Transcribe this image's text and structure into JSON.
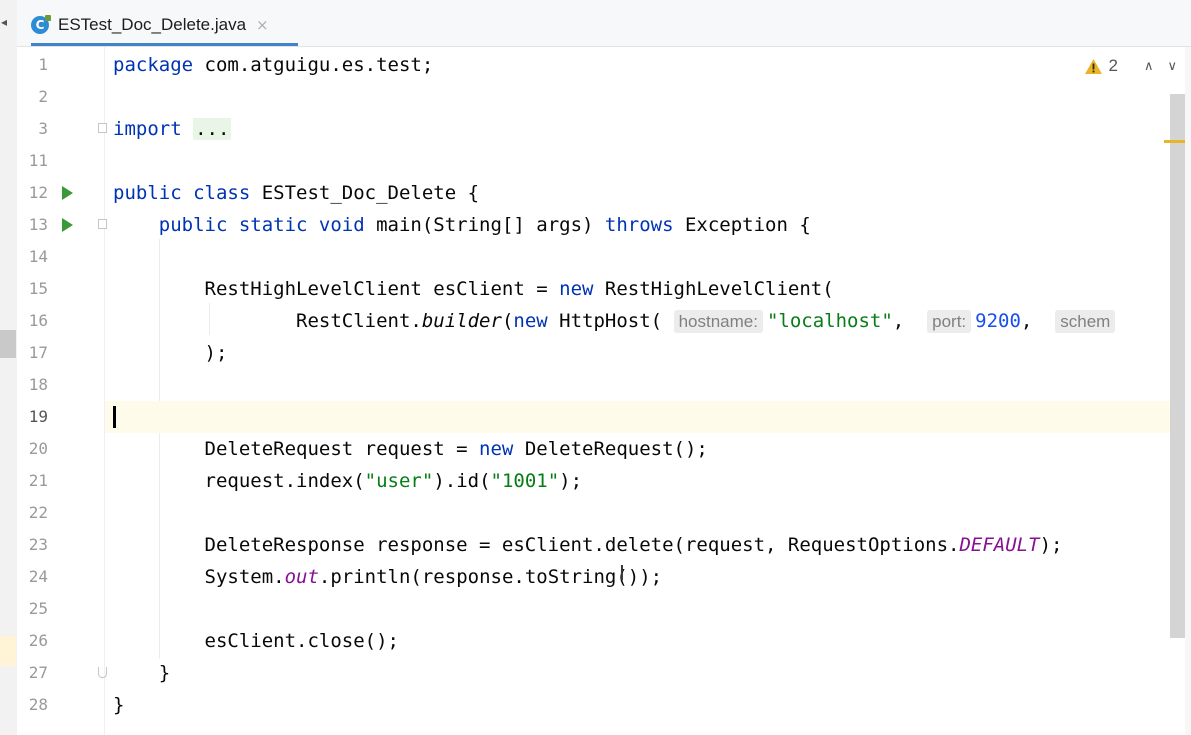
{
  "tab": {
    "icon_letter": "C",
    "file_name": "ESTest_Doc_Delete.java",
    "close": "×"
  },
  "inspection": {
    "warning_count": "2",
    "prev": "∧",
    "next": "∨"
  },
  "colors": {
    "keyword": "#0033b3",
    "string": "#067d17",
    "number": "#1750eb",
    "static_field": "#871094",
    "run_icon": "#3a9a3a",
    "warning": "#e8b429"
  },
  "lines": [
    {
      "num": "1",
      "parts": [
        [
          "kw",
          "package"
        ],
        [
          "t",
          " com.atguigu.es.test;"
        ]
      ]
    },
    {
      "num": "2",
      "parts": []
    },
    {
      "num": "3",
      "fold": "start",
      "parts": [
        [
          "kw",
          "import"
        ],
        [
          "t",
          " "
        ],
        [
          "folded",
          "..."
        ]
      ]
    },
    {
      "num": "11",
      "parts": []
    },
    {
      "num": "12",
      "run": true,
      "parts": [
        [
          "kw",
          "public class"
        ],
        [
          "t",
          " ESTest_Doc_Delete {"
        ]
      ]
    },
    {
      "num": "13",
      "run": true,
      "fold": "start",
      "parts": [
        [
          "t",
          "    "
        ],
        [
          "kw",
          "public static void"
        ],
        [
          "t",
          " main(String[] args) "
        ],
        [
          "kw",
          "throws"
        ],
        [
          "t",
          " Exception {"
        ]
      ]
    },
    {
      "num": "14",
      "parts": []
    },
    {
      "num": "15",
      "parts": [
        [
          "t",
          "        RestHighLevelClient esClient = "
        ],
        [
          "kw",
          "new"
        ],
        [
          "t",
          " RestHighLevelClient("
        ]
      ]
    },
    {
      "num": "16",
      "parts": [
        [
          "t",
          "                RestClient."
        ],
        [
          "ital",
          "builder"
        ],
        [
          "t",
          "("
        ],
        [
          "kw",
          "new"
        ],
        [
          "t",
          " HttpHost( "
        ],
        [
          "hint",
          "hostname:"
        ],
        [
          "str",
          "\"localhost\""
        ],
        [
          "t",
          ",  "
        ],
        [
          "hint",
          "port:"
        ],
        [
          "num",
          "9200"
        ],
        [
          "t",
          ",  "
        ],
        [
          "hint",
          "schem"
        ]
      ]
    },
    {
      "num": "17",
      "parts": [
        [
          "t",
          "        );"
        ]
      ]
    },
    {
      "num": "18",
      "parts": []
    },
    {
      "num": "19",
      "current": true,
      "parts": []
    },
    {
      "num": "20",
      "parts": [
        [
          "t",
          "        DeleteRequest request = "
        ],
        [
          "kw",
          "new"
        ],
        [
          "t",
          " DeleteRequest();"
        ]
      ]
    },
    {
      "num": "21",
      "parts": [
        [
          "t",
          "        request.index("
        ],
        [
          "str",
          "\"user\""
        ],
        [
          "t",
          ").id("
        ],
        [
          "str",
          "\"1001\""
        ],
        [
          "t",
          ");"
        ]
      ]
    },
    {
      "num": "22",
      "parts": []
    },
    {
      "num": "23",
      "parts": [
        [
          "t",
          "        DeleteResponse response = esClient.delete(request, RequestOptions."
        ],
        [
          "stat",
          "DEFAULT"
        ],
        [
          "t",
          ");"
        ]
      ]
    },
    {
      "num": "24",
      "parts": [
        [
          "t",
          "        System."
        ],
        [
          "stat",
          "out"
        ],
        [
          "t",
          ".println(response.toString());"
        ]
      ]
    },
    {
      "num": "25",
      "parts": []
    },
    {
      "num": "26",
      "parts": [
        [
          "t",
          "        esClient.close();"
        ]
      ]
    },
    {
      "num": "27",
      "fold": "end",
      "parts": [
        [
          "t",
          "    }"
        ]
      ]
    },
    {
      "num": "28",
      "parts": [
        [
          "t",
          "}"
        ]
      ]
    }
  ]
}
